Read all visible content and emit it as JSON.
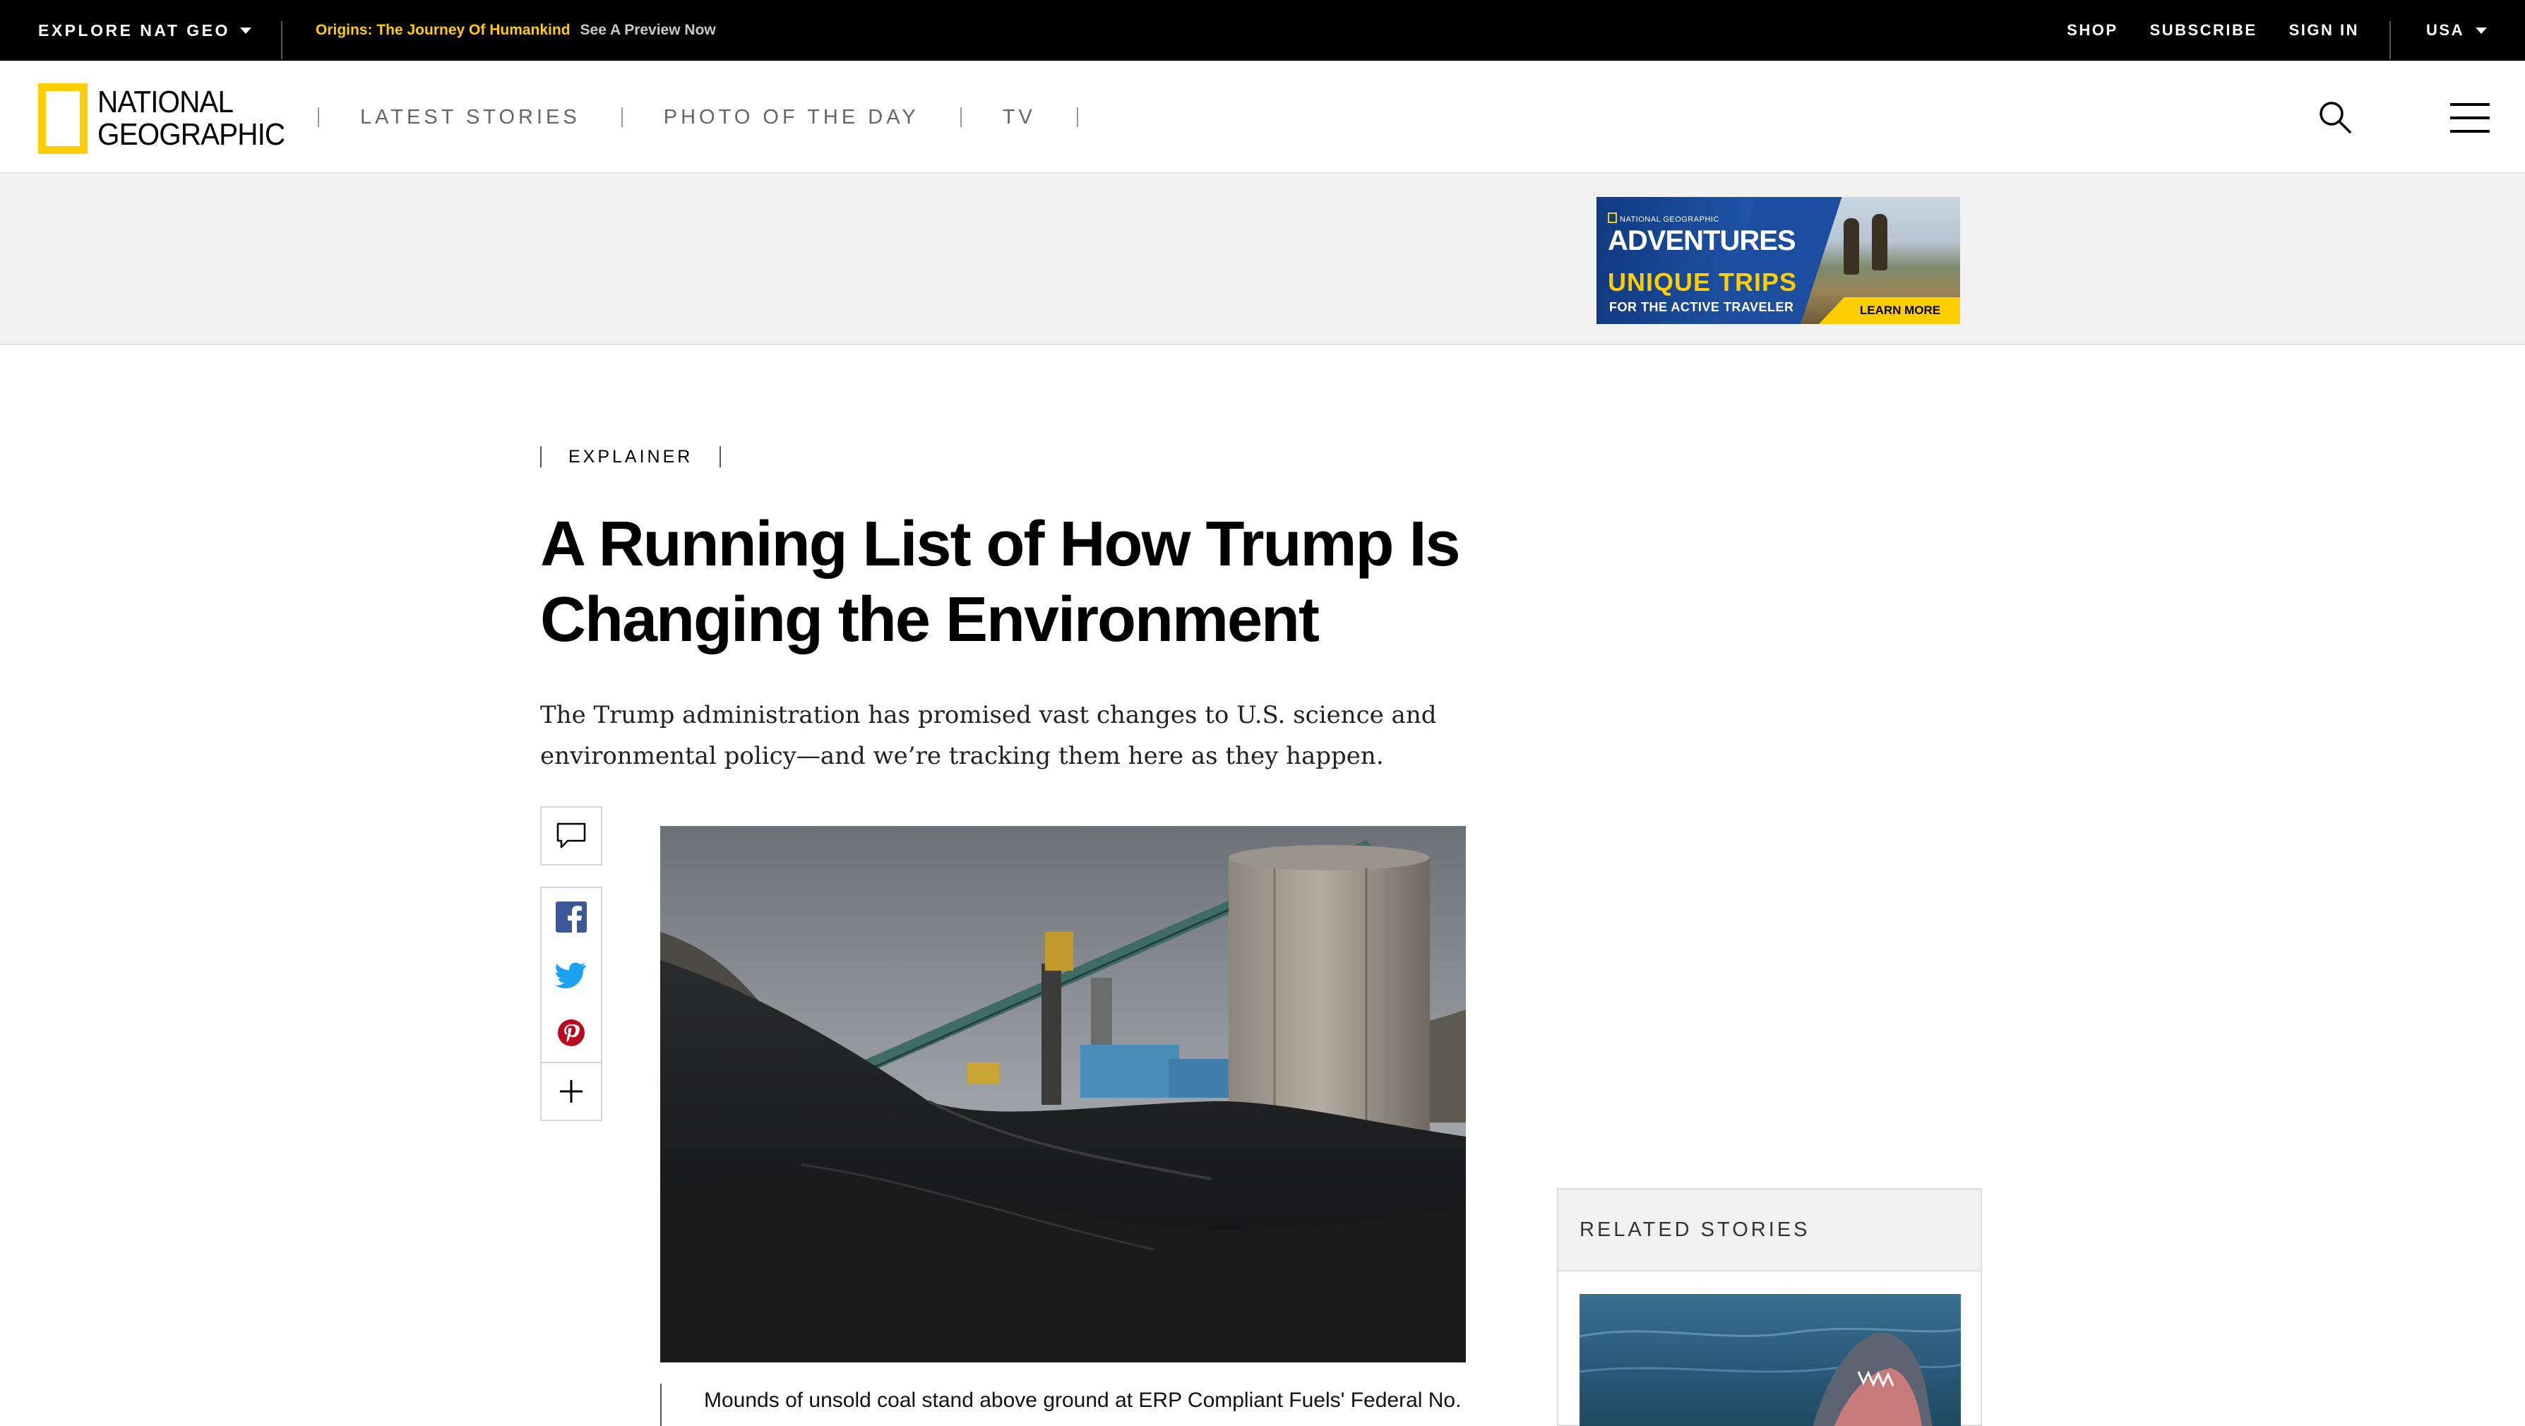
{
  "topbar": {
    "explore_label": "EXPLORE NAT GEO",
    "promo_title": "Origins: The Journey Of Humankind",
    "promo_cta": "See A Preview Now",
    "links": [
      "SHOP",
      "SUBSCRIBE",
      "SIGN IN"
    ],
    "region": "USA"
  },
  "header": {
    "logo_line1": "NATIONAL",
    "logo_line2": "GEOGRAPHIC",
    "nav": [
      "LATEST STORIES",
      "PHOTO OF THE DAY",
      "TV"
    ]
  },
  "ad": {
    "brand_small": "NATIONAL GEOGRAPHIC",
    "title": "ADVENTURES",
    "headline": "UNIQUE TRIPS",
    "subline": "FOR THE ACTIVE TRAVELER",
    "cta": "LEARN MORE"
  },
  "article": {
    "kicker": "EXPLAINER",
    "headline": "A Running List of How Trump Is Changing the Environment",
    "dek": "The Trump administration has promised vast changes to U.S. science and environmental policy—and we’re tracking them here as they happen.",
    "caption": "Mounds of unsold coal stand above ground at ERP Compliant Fuels' Federal No."
  },
  "related": {
    "heading": "RELATED STORIES"
  },
  "colors": {
    "brand_yellow": "#ffce00",
    "facebook": "#3b5998",
    "twitter": "#1da1f2",
    "pinterest": "#bd081c"
  }
}
